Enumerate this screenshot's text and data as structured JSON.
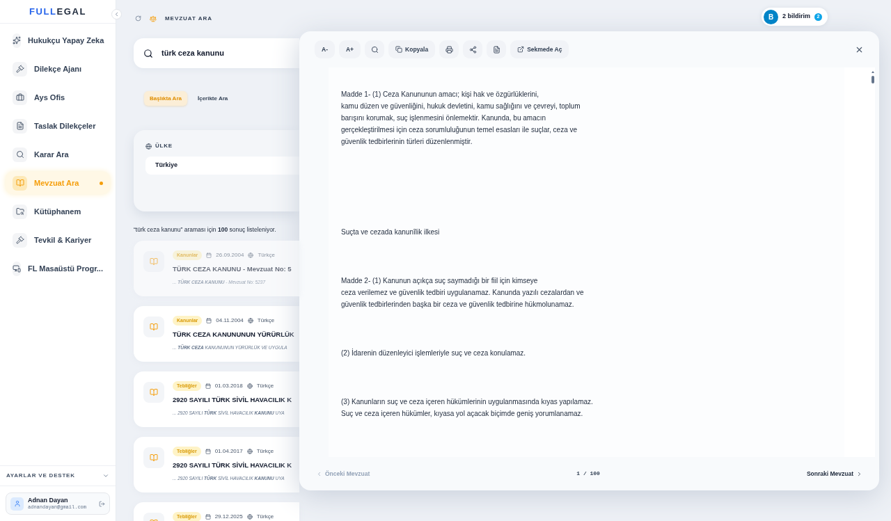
{
  "brand": {
    "part1": "FULL",
    "part2": "EGAL"
  },
  "sidebar": {
    "items": [
      {
        "label": "Hukukçu Yapay Zeka",
        "selected": false
      },
      {
        "label": "Dilekçe Ajanı",
        "selected": false
      },
      {
        "label": "Ays Ofis",
        "selected": false
      },
      {
        "label": "Taslak Dilekçeler",
        "selected": false
      },
      {
        "label": "Karar Ara",
        "selected": false
      },
      {
        "label": "Mevzuat Ara",
        "selected": true
      },
      {
        "label": "Kütüphanem",
        "selected": false
      },
      {
        "label": "Tevkil & Kariyer",
        "selected": false
      },
      {
        "label": "FL Masaüstü Progr...",
        "selected": false
      }
    ],
    "settings_label": "AYARLAR VE DESTEK",
    "user": {
      "name": "Adnan Dayan",
      "email": "adnandayan@gmail.com"
    }
  },
  "header": {
    "breadcrumb": "MEVZUAT ARA",
    "notifications": {
      "avatar": "B",
      "label": "2 bildirim",
      "count": "2"
    }
  },
  "search": {
    "value": "türk ceza kanunu"
  },
  "search_modes": [
    {
      "label": "Başlıkta Ara",
      "selected": true
    },
    {
      "label": "İçerikte Ara",
      "selected": false
    }
  ],
  "filter": {
    "label": "ÜLKE",
    "value": "Türkiye"
  },
  "result_summary": "“türk ceza kanunu” araması için **100** sonuç listeleniyor.",
  "results": [
    {
      "tag": "Kanunlar",
      "date": "26.09.2004",
      "language": "Türkçe",
      "title": "TÜRK CEZA KANUNU - Mevzuat No: 5",
      "snippet": "... **TÜRK CEZA KANUNU** - Mevzuat No: 5237",
      "selected": true
    },
    {
      "tag": "Kanunlar",
      "date": "04.11.2004",
      "language": "Türkçe",
      "title": "TÜRK CEZA KANUNUNUN YÜRÜRLÜK",
      "snippet": "... **TÜRK CEZA** KANUNUNUN YÜRÜRLÜK VE UYGULA",
      "selected": false
    },
    {
      "tag": "Tebliğler",
      "date": "01.03.2018",
      "language": "Türkçe",
      "title": "2920 SAYILI TÜRK SİVİL HAVACILIK K",
      "snippet": "... 2920 SAYILI **TÜRK** SİVİL HAVACILIK **KANUNU** UYA",
      "selected": false
    },
    {
      "tag": "Tebliğler",
      "date": "01.04.2017",
      "language": "Türkçe",
      "title": "2920 SAYILI TÜRK SİVİL HAVACILIK K",
      "snippet": "... 2920 SAYILI **TÜRK** SİVİL HAVACILIK **KANUNU** UYA",
      "selected": false
    },
    {
      "tag": "Tebliğler",
      "date": "29.12.2025",
      "language": "Türkçe",
      "selected": false
    }
  ],
  "viewer": {
    "toolbar": [
      {
        "kind": "text",
        "label": "A-"
      },
      {
        "kind": "text",
        "label": "A+"
      },
      {
        "kind": "icon"
      },
      {
        "kind": "text",
        "label": "Kopyala"
      },
      {
        "kind": "icon"
      },
      {
        "kind": "icon"
      },
      {
        "kind": "icon"
      },
      {
        "kind": "text",
        "label": "Sekmede Aç"
      }
    ],
    "paragraphs": [
      [
        "Madde 1- (1) Ceza Kanununun amacı; kişi hak ve özgürlüklerini,",
        "kamu düzen ve güvenliğini, hukuk devletini, kamu sağlığını ve çevreyi, toplum barışını korumak, suç işlenmesini önlemektir. Kanunda, bu amacın gerçekleştirilmesi için ceza sorumluluğunun temel esasları ile suçlar, ceza ve güvenlik tedbirlerinin türleri düzenlenmiştir."
      ],
      [
        "Suçta ve cezada kanunîlik ilkesi"
      ],
      [
        "Madde 2- (1) Kanunun açıkça suç saymadığı bir fiil için kimseye",
        "ceza verilemez ve güvenlik tedbiri uygulanamaz. Kanunda yazılı cezalardan ve güvenlik tedbirlerinden başka bir ceza ve güvenlik tedbirine hükmolunamaz."
      ],
      [
        "(2) İdarenin düzenleyici işlemleriyle suç ve ceza konulamaz."
      ],
      [
        "(3) Kanunların suç ve ceza içeren hükümlerinin uygulanmasında kıyas yapılamaz. Suç ve ceza içeren hükümler, kıyasa yol açacak biçimde geniş yorumlanamaz."
      ]
    ],
    "prev": {
      "label": "Önceki Mevzuat",
      "disabled": true
    },
    "page": "1 / 100",
    "next": {
      "label": "Sonraki Mevzuat",
      "disabled": false
    }
  }
}
